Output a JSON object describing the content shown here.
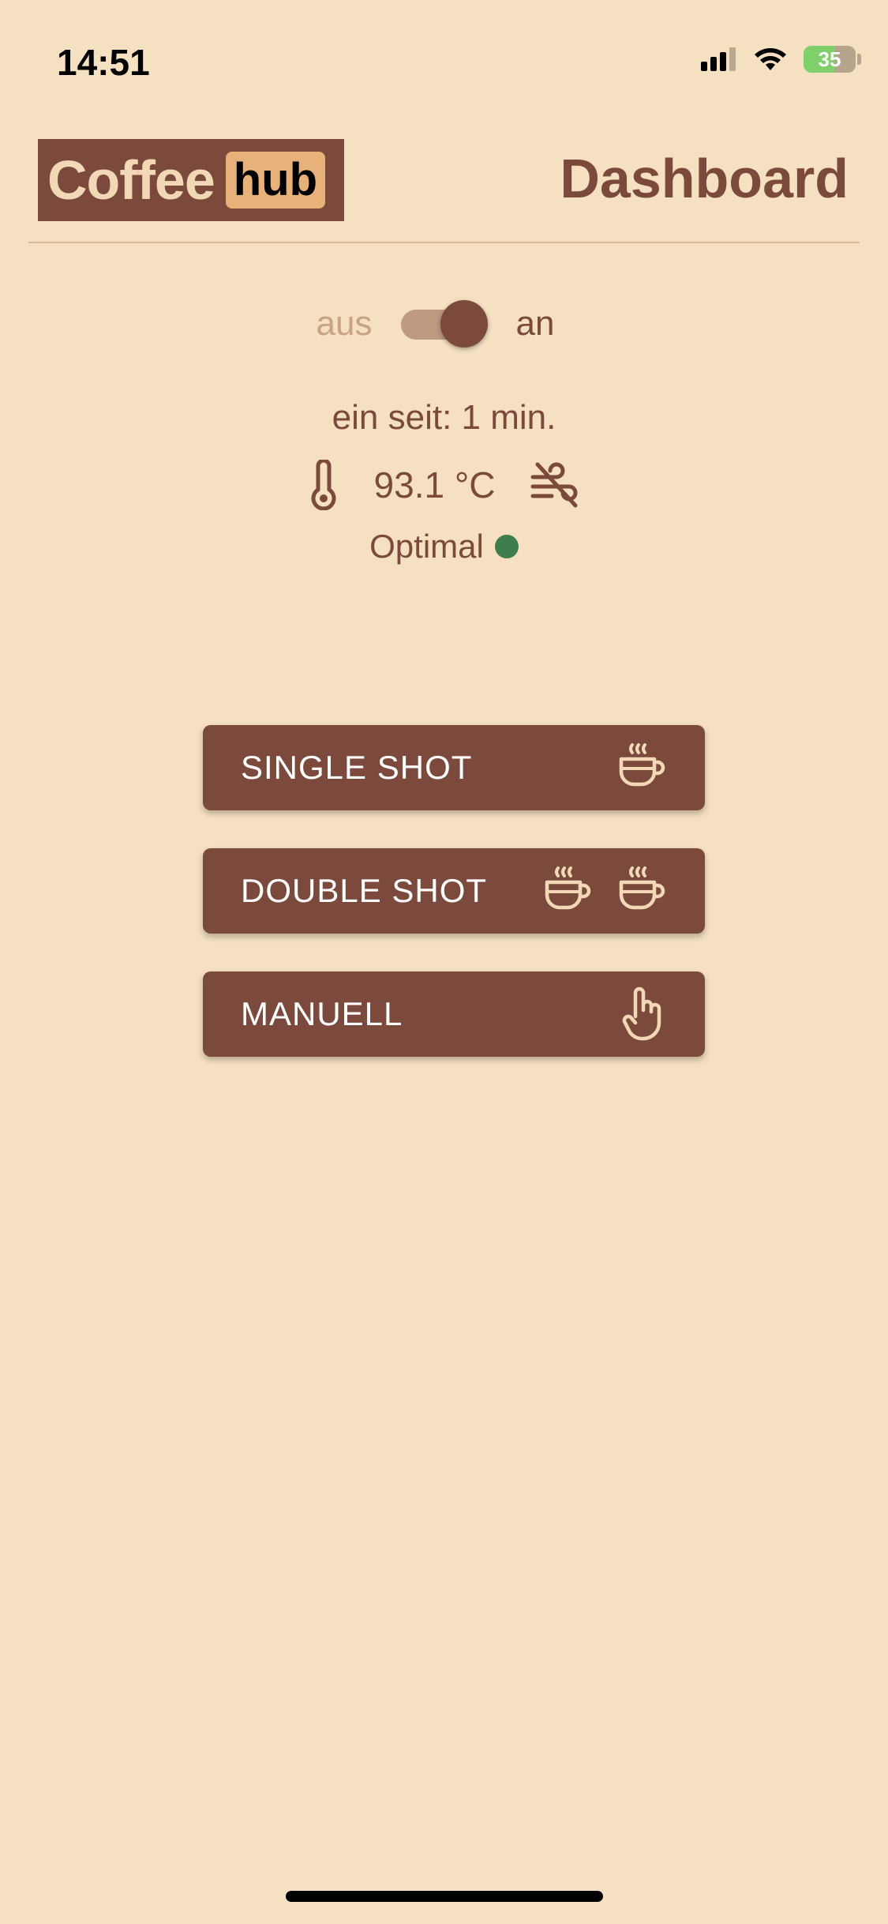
{
  "status_bar": {
    "time": "14:51",
    "battery": "35"
  },
  "header": {
    "logo_part1": "Coffee",
    "logo_part2": "hub",
    "title": "Dashboard"
  },
  "power": {
    "off_label": "aus",
    "on_label": "an",
    "state": "on"
  },
  "info": {
    "since": "ein seit: 1 min.",
    "temperature": "93.1 °C",
    "status": "Optimal",
    "status_color": "#3f7d4f"
  },
  "actions": [
    {
      "label": "SINGLE SHOT",
      "icon": "coffee-cup-icon"
    },
    {
      "label": "DOUBLE SHOT",
      "icon": "double-coffee-cup-icon"
    },
    {
      "label": "MANUELL",
      "icon": "hand-pointer-icon"
    }
  ],
  "colors": {
    "background": "#f5e0c1",
    "brand": "#7b4a3d",
    "accent": "#e7b27a"
  }
}
